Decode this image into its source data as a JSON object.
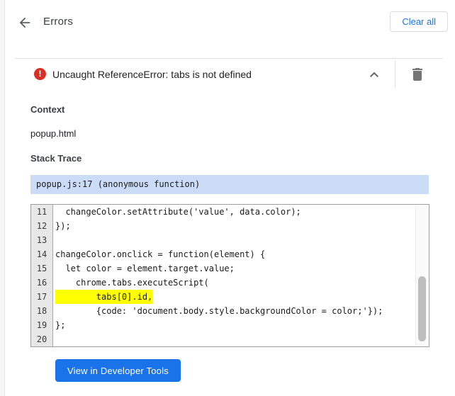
{
  "header": {
    "title": "Errors",
    "clear_all_label": "Clear all",
    "back_icon": "arrow-left-icon"
  },
  "error_item": {
    "message": "Uncaught ReferenceError: tabs is not defined",
    "severity_icon": "error-circle-icon",
    "severity_glyph": "!",
    "collapse_icon": "chevron-up-icon",
    "delete_icon": "trash-icon",
    "expanded": true
  },
  "details": {
    "context_label": "Context",
    "context_value": "popup.html",
    "stack_trace_label": "Stack Trace",
    "selected_stack_frame": "popup.js:17 (anonymous function)"
  },
  "code": {
    "first_line_number": 11,
    "lines": [
      {
        "number": "11",
        "text": "  changeColor.setAttribute('value', data.color);",
        "highlight": false
      },
      {
        "number": "12",
        "text": "});",
        "highlight": false
      },
      {
        "number": "13",
        "text": "",
        "highlight": false
      },
      {
        "number": "14",
        "text": "changeColor.onclick = function(element) {",
        "highlight": false
      },
      {
        "number": "15",
        "text": "  let color = element.target.value;",
        "highlight": false
      },
      {
        "number": "16",
        "text": "    chrome.tabs.executeScript(",
        "highlight": false
      },
      {
        "number": "17",
        "text": "        tabs[0].id,",
        "highlight": true
      },
      {
        "number": "18",
        "text": "        {code: 'document.body.style.backgroundColor = color;'});",
        "highlight": false
      },
      {
        "number": "19",
        "text": "};",
        "highlight": false
      },
      {
        "number": "20",
        "text": "",
        "highlight": false
      }
    ],
    "highlighted_line": "17",
    "scrollbar": "vertical-thumb-lower"
  },
  "footer": {
    "devtools_button_label": "View in Developer Tools"
  },
  "colors": {
    "accent_blue": "#1a73e8",
    "error_red": "#d93025",
    "highlight_yellow": "#ffff00",
    "selected_frame_blue": "#cbdcf6"
  }
}
